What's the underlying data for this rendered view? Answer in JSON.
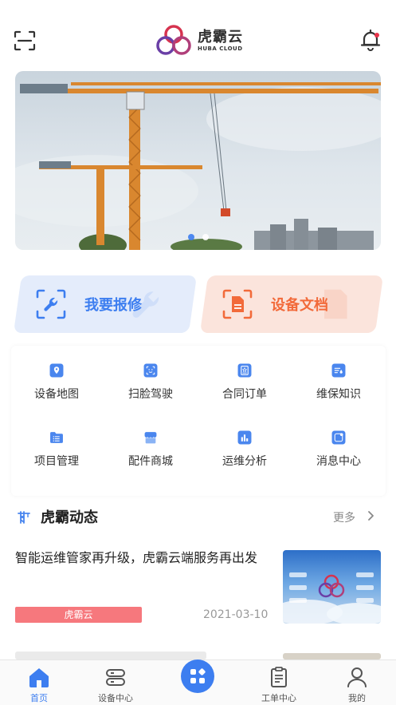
{
  "header": {
    "logo_cn": "虎霸云",
    "logo_en": "HUBA CLOUD",
    "scan_icon": "scan-icon",
    "bell_icon": "bell-icon"
  },
  "banner": {
    "image": "tower-cranes-photo",
    "slides": 2,
    "active_slide": 1
  },
  "quick_actions": [
    {
      "label": "我要报修",
      "icon": "wrench-icon",
      "color": "#3d7ef0"
    },
    {
      "label": "设备文档",
      "icon": "document-icon",
      "color": "#f26a3a"
    }
  ],
  "grid": [
    {
      "label": "设备地图",
      "icon": "map-pin-icon"
    },
    {
      "label": "扫脸驾驶",
      "icon": "face-scan-icon"
    },
    {
      "label": "合同订单",
      "icon": "contract-icon"
    },
    {
      "label": "维保知识",
      "icon": "knowledge-icon"
    },
    {
      "label": "项目管理",
      "icon": "project-icon"
    },
    {
      "label": "配件商城",
      "icon": "shop-icon"
    },
    {
      "label": "运维分析",
      "icon": "bar-chart-icon"
    },
    {
      "label": "消息中心",
      "icon": "message-icon"
    }
  ],
  "news": {
    "title": "虎霸动态",
    "more": "更多",
    "items": [
      {
        "title": "智能运维管家再升级，虎霸云端服务再出发",
        "tag": "虎霸云",
        "date": "2021-03-10"
      }
    ]
  },
  "tabbar": [
    {
      "label": "首页",
      "icon": "home-icon",
      "active": true
    },
    {
      "label": "设备中心",
      "icon": "device-icon",
      "active": false
    },
    {
      "label": "",
      "icon": "grid-apps-icon",
      "active": false
    },
    {
      "label": "工单中心",
      "icon": "clipboard-icon",
      "active": false
    },
    {
      "label": "我的",
      "icon": "user-icon",
      "active": false
    }
  ],
  "colors": {
    "primary": "#3d7ef0",
    "accent": "#f26a3a",
    "tag": "#f6787d",
    "logo_red": "#d6334f",
    "logo_purple": "#6a3fa6"
  }
}
